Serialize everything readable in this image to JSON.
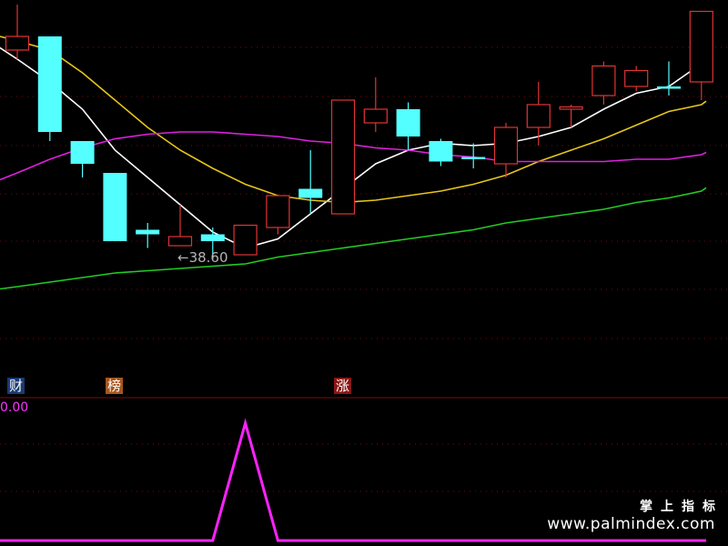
{
  "chart_data": [
    {
      "type": "candlestick",
      "title": "",
      "ylim": [
        36.0,
        44.0
      ],
      "grid": true,
      "candles": [
        {
          "o": 42.9,
          "c": 43.2,
          "h": 43.9,
          "l": 42.7,
          "dir": "up"
        },
        {
          "o": 43.2,
          "c": 41.1,
          "h": 43.2,
          "l": 40.9,
          "dir": "down"
        },
        {
          "o": 40.9,
          "c": 40.4,
          "h": 40.9,
          "l": 40.1,
          "dir": "down"
        },
        {
          "o": 40.2,
          "c": 38.7,
          "h": 40.2,
          "l": 38.7,
          "dir": "down"
        },
        {
          "o": 38.95,
          "c": 38.85,
          "h": 39.1,
          "l": 38.55,
          "dir": "down"
        },
        {
          "o": 38.6,
          "c": 38.8,
          "h": 39.5,
          "l": 38.6,
          "dir": "up"
        },
        {
          "o": 38.85,
          "c": 38.7,
          "h": 39.0,
          "l": 38.3,
          "dir": "down"
        },
        {
          "o": 38.4,
          "c": 39.05,
          "h": 39.05,
          "l": 38.4,
          "dir": "up"
        },
        {
          "o": 39.0,
          "c": 39.7,
          "h": 39.7,
          "l": 38.85,
          "dir": "up"
        },
        {
          "o": 39.85,
          "c": 39.65,
          "h": 40.7,
          "l": 39.3,
          "dir": "down"
        },
        {
          "o": 39.3,
          "c": 41.8,
          "h": 41.8,
          "l": 39.3,
          "dir": "up"
        },
        {
          "o": 41.3,
          "c": 41.6,
          "h": 42.3,
          "l": 41.1,
          "dir": "up"
        },
        {
          "o": 41.6,
          "c": 41.0,
          "h": 41.75,
          "l": 40.7,
          "dir": "down"
        },
        {
          "o": 40.9,
          "c": 40.45,
          "h": 40.95,
          "l": 40.35,
          "dir": "down"
        },
        {
          "o": 40.55,
          "c": 40.5,
          "h": 40.85,
          "l": 40.3,
          "dir": "down"
        },
        {
          "o": 40.4,
          "c": 41.2,
          "h": 41.3,
          "l": 40.1,
          "dir": "up"
        },
        {
          "o": 41.2,
          "c": 41.7,
          "h": 42.2,
          "l": 40.8,
          "dir": "up"
        },
        {
          "o": 41.6,
          "c": 41.65,
          "h": 41.7,
          "l": 41.2,
          "dir": "up"
        },
        {
          "o": 41.9,
          "c": 42.55,
          "h": 42.65,
          "l": 41.7,
          "dir": "up"
        },
        {
          "o": 42.1,
          "c": 42.45,
          "h": 42.55,
          "l": 42.0,
          "dir": "up"
        },
        {
          "o": 42.1,
          "c": 42.05,
          "h": 42.65,
          "l": 41.9,
          "dir": "down"
        },
        {
          "o": 42.2,
          "c": 43.75,
          "h": 43.75,
          "l": 41.8,
          "dir": "up"
        }
      ],
      "moving_averages": [
        {
          "color": "#ffffff",
          "values": [
            42.7,
            42.2,
            41.6,
            40.7,
            40.1,
            39.5,
            38.9,
            38.55,
            38.75,
            39.3,
            39.85,
            40.4,
            40.7,
            40.85,
            40.8,
            40.85,
            41.0,
            41.2,
            41.6,
            41.95,
            42.1,
            42.6
          ]
        },
        {
          "color": "#e6c619",
          "values": [
            43.1,
            42.9,
            42.4,
            41.8,
            41.2,
            40.7,
            40.3,
            39.95,
            39.7,
            39.6,
            39.55,
            39.6,
            39.7,
            39.8,
            39.95,
            40.15,
            40.45,
            40.7,
            40.95,
            41.25,
            41.55,
            41.7
          ]
        },
        {
          "color": "#e020e0",
          "values": [
            40.2,
            40.5,
            40.75,
            40.95,
            41.05,
            41.1,
            41.1,
            41.05,
            41.0,
            40.9,
            40.85,
            40.75,
            40.7,
            40.6,
            40.55,
            40.45,
            40.45,
            40.45,
            40.45,
            40.5,
            40.5,
            40.6
          ]
        },
        {
          "color": "#22cc22",
          "values": [
            37.7,
            37.8,
            37.9,
            38.0,
            38.05,
            38.1,
            38.15,
            38.2,
            38.35,
            38.45,
            38.55,
            38.65,
            38.75,
            38.85,
            38.95,
            39.1,
            39.2,
            39.3,
            39.4,
            39.55,
            39.65,
            39.8
          ]
        }
      ],
      "annotation": {
        "candle_index": 5,
        "label": "←38.60",
        "color": "#b4b4b4"
      }
    },
    {
      "type": "line",
      "ylim": [
        0,
        1
      ],
      "series": [
        {
          "color": "#ff22ff",
          "values": [
            0,
            0,
            0,
            0,
            0,
            0,
            0,
            1,
            0,
            0,
            0,
            0,
            0,
            0,
            0,
            0,
            0,
            0,
            0,
            0,
            0,
            0
          ]
        }
      ]
    }
  ],
  "badges": [
    {
      "text": "财",
      "style": "blue"
    },
    {
      "text": "榜",
      "style": "orange"
    },
    {
      "text": "涨",
      "style": "red"
    }
  ],
  "indicator_value": "0.00",
  "watermark": {
    "title": "掌上指标",
    "url": "www.palmindex.com"
  },
  "colors": {
    "up": "#e03434",
    "down": "#54ffff",
    "grid": "#7a0a0a",
    "background": "#000000"
  }
}
